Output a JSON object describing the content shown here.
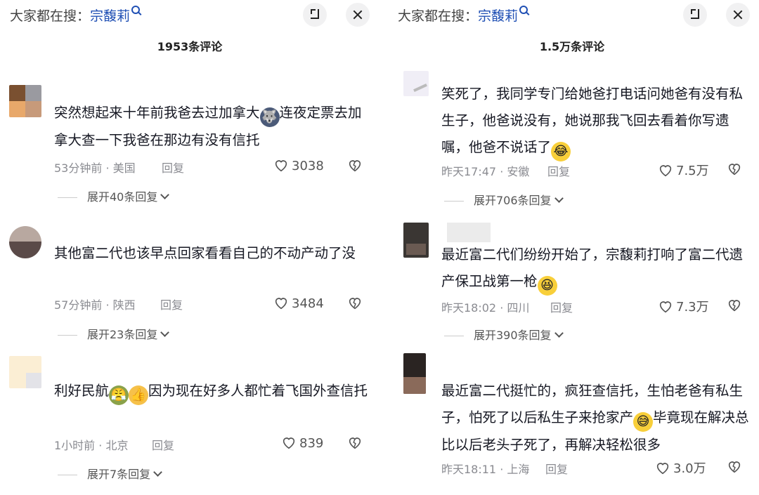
{
  "left": {
    "search_prefix": "大家都在搜：",
    "search_keyword": "宗馥莉",
    "comment_count": "1953条评论",
    "comments": [
      {
        "text_before": "突然想起来十年前我爸去过加拿大",
        "emoji": "wolf-face",
        "text_after": "连夜定票去加拿大查一下我爸在那边有没有信托",
        "time": "53分钟前 · 美国",
        "reply": "回复",
        "likes": "3038",
        "expand": "展开40条回复"
      },
      {
        "text_before": "其他富二代也该早点回家看看自己的不动产动了没",
        "emoji": "",
        "text_after": "",
        "time": "57分钟前 · 陕西",
        "reply": "回复",
        "likes": "3484",
        "expand": "展开23条回复"
      },
      {
        "text_before": "利好民航",
        "emoji": "soldier-face thumbs-up",
        "text_after": "因为现在好多人都忙着飞国外查信托",
        "time": "1小时前 · 北京",
        "reply": "回复",
        "likes": "839",
        "expand": "展开7条回复"
      }
    ]
  },
  "right": {
    "search_prefix": "大家都在搜：",
    "search_keyword": "宗馥莉",
    "comment_count": "1.5万条评论",
    "comments": [
      {
        "text_before": "笑死了，我同学专门给她爸打电话问她爸有没有私生子，他爸说没有，她说那我飞回去看着你写遗嘱，他爸不说话了",
        "emoji": "laughing-crying-face",
        "text_after": "",
        "time": "昨天17:47 · 安徽",
        "reply": "回复",
        "likes": "7.5万",
        "expand": "展开706条回复"
      },
      {
        "text_before": "最近富二代们纷纷开始了，宗馥莉打响了富二代遗产保卫战第一枪",
        "emoji": "laughing-face",
        "text_after": "",
        "time": "昨天18:02 · 四川",
        "reply": "回复",
        "likes": "7.3万",
        "expand": "展开390条回复"
      },
      {
        "text_before": "最近富二代挺忙的，疯狂查信托，生怕老爸有私生子，怕死了以后私生子来抢家产",
        "emoji": "grinning-sweat-face",
        "text_after": "毕竟现在解决总比以后老头子死了，再解决轻松很多",
        "time": "昨天18:11 · 上海",
        "reply": "回复",
        "likes": "3.0万",
        "expand": ""
      }
    ]
  },
  "colors": {
    "keyword": "#1f4fb4",
    "meta": "#8a8b91",
    "text": "#161823"
  }
}
